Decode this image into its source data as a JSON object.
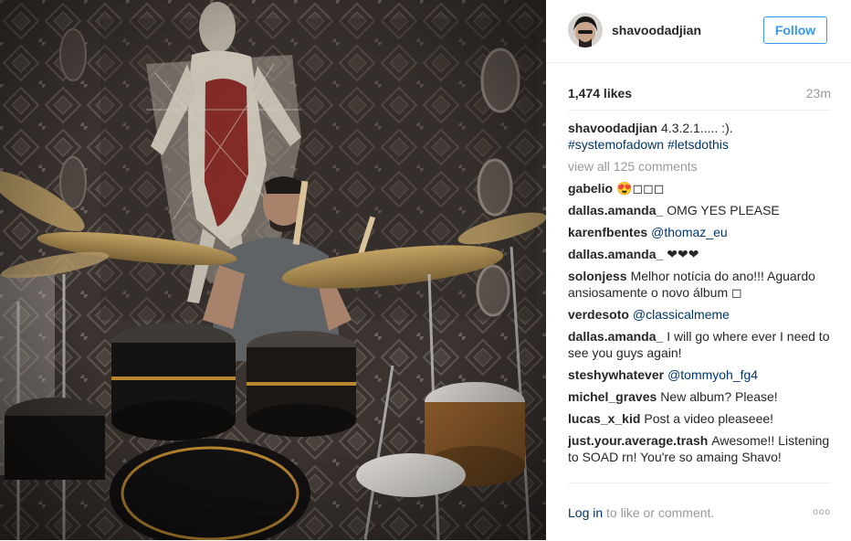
{
  "post": {
    "owner": "shavoodadjian",
    "follow_label": "Follow",
    "likes": "1,474 likes",
    "time_ago": "23m",
    "caption": {
      "user": "shavoodadjian",
      "text": "4.3.2.1..... :).",
      "hashtags": "#systemofadown #letsdothis"
    },
    "view_all_comments": "view all 125 comments",
    "comments": [
      {
        "user": "gabelio",
        "text": "😍◻◻◻"
      },
      {
        "user": "dallas.amanda_",
        "text": "OMG YES PLEASE"
      },
      {
        "user": "karenfbentes",
        "mention": "@thomaz_eu"
      },
      {
        "user": "dallas.amanda_",
        "text": "❤❤❤"
      },
      {
        "user": "solonjess",
        "text": "Melhor notícia do ano!!! Aguardo ansiosamente o novo álbum ◻"
      },
      {
        "user": "verdesoto",
        "mention": "@classicalmeme"
      },
      {
        "user": "dallas.amanda_",
        "text": "I will go where ever I need to see you guys again!"
      },
      {
        "user": "steshywhatever",
        "mention": "@tommyoh_fg4"
      },
      {
        "user": "michel_graves",
        "text": "New album? Please!"
      },
      {
        "user": "lucas_x_kid",
        "text": "Post a video pleaseee!"
      },
      {
        "user": "just.your.average.trash",
        "text": "Awesome!! Listening to SOAD rn! You're so amaing Shavo!"
      }
    ],
    "footer": {
      "login_link": "Log in",
      "login_rest": "to like or comment.",
      "more_options": "ooo",
      "more_icon": "more-options-icon"
    }
  }
}
